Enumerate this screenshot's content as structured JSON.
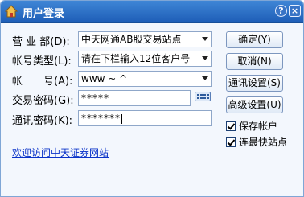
{
  "window": {
    "title": "用户登录",
    "help_glyph": "?",
    "close_glyph": "×"
  },
  "form": {
    "server_label": "营 业 部(D):",
    "server_value": "中天网通AB股交易站点",
    "account_type_label": "帐号类型(L):",
    "account_type_value": "请在下栏输入12位客户号",
    "account_label": "帐　　号(A):",
    "account_value": "www ~ ^",
    "trade_pwd_label": "交易密码(G):",
    "trade_pwd_value": "*****",
    "comm_pwd_label": "通讯密码(K):",
    "comm_pwd_value": "*******"
  },
  "buttons": {
    "ok": "确定(Y)",
    "cancel": "取消(N)",
    "comm_settings": "通讯设置(S)",
    "advanced": "高级设置(U)"
  },
  "options": {
    "save_account": "保存帐户",
    "fastest_site": "连最快站点"
  },
  "footer": {
    "link_text": "欢迎访问中天证券网站"
  },
  "colors": {
    "titlebar": "#2a6fc8",
    "background": "#f3f7fd",
    "link": "#0a33c9"
  },
  "icons": {
    "app": "house-icon",
    "keyboard": "keyboard-icon"
  }
}
